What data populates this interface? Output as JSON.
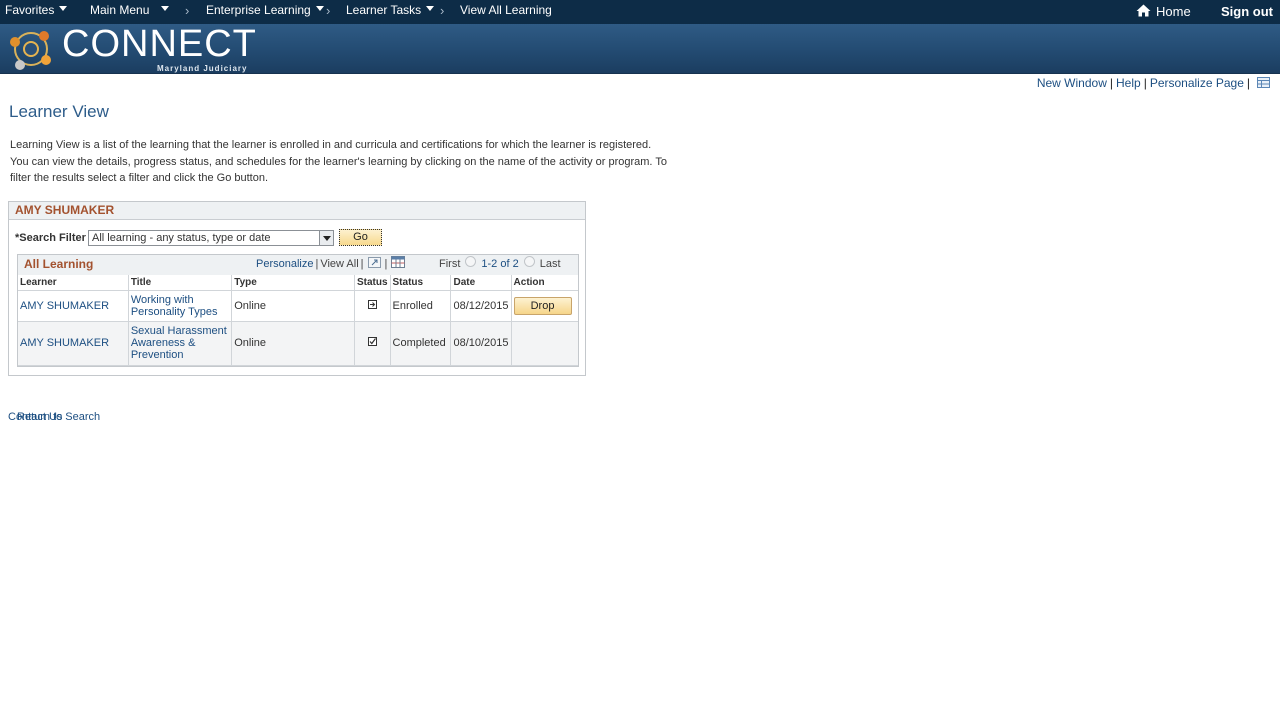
{
  "topnav": {
    "favorites": "Favorites",
    "main_menu": "Main Menu",
    "breadcrumb": [
      "Enterprise Learning",
      "Learner Tasks",
      "View All Learning"
    ],
    "separator": "›",
    "home": "Home",
    "sign_out": "Sign out"
  },
  "banner": {
    "logo_text": "CONNECT",
    "logo_sub": "Maryland Judiciary"
  },
  "page_links": {
    "new_window": "New Window",
    "help": "Help",
    "personalize_page": "Personalize Page",
    "separator": "|"
  },
  "page": {
    "title": "Learner View",
    "intro": "Learning View is a list of the learning that the learner is enrolled in and curricula and certifications for which the learner is registered. You can view the details, progress status, and schedules for the learner's learning by clicking on the name of the activity or program. To filter the results select a filter and click the Go button."
  },
  "learner": {
    "name": "AMY SHUMAKER",
    "filter_required": "*",
    "filter_label": "Search Filter",
    "filter_value": "All learning - any status, type or date",
    "go": "Go"
  },
  "grid": {
    "title": "All Learning",
    "personalize": "Personalize",
    "view_all": "View All",
    "separator": "|",
    "first": "First",
    "count": "1-2 of 2",
    "last": "Last",
    "columns": [
      "Learner",
      "Title",
      "Type",
      "Status",
      "Status",
      "Date",
      "Action"
    ],
    "rows": [
      {
        "learner": "AMY SHUMAKER",
        "title": "Working with Personality Types",
        "type": "Online",
        "status_icon": "enrolled-icon",
        "status": "Enrolled",
        "date": "08/12/2015",
        "action": "Drop"
      },
      {
        "learner": "AMY SHUMAKER",
        "title": "Sexual Harassment Awareness & Prevention",
        "type": "Online",
        "status_icon": "completed-check-icon",
        "status": "Completed",
        "date": "08/10/2015",
        "action": ""
      }
    ]
  },
  "footer": {
    "contact_us": "Contact Us",
    "return_to_search": "Return to Search"
  }
}
